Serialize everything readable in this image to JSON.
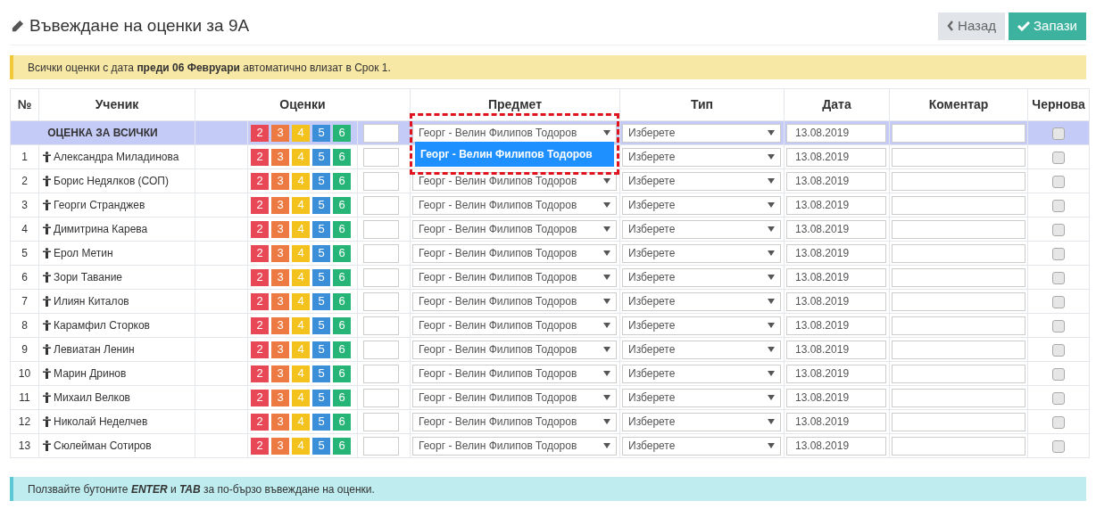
{
  "page_title": "Въвеждане на оценки за 9А",
  "buttons": [
    {
      "kind": "back",
      "label": "Назад"
    },
    {
      "kind": "save",
      "label": "Запази"
    }
  ],
  "notice": "Всички оценки с дата **преди 06 Февруари** автоматично влизат в Срок 1.",
  "table": {
    "columns": [
      "№",
      "Ученик",
      "Оценки",
      "Предмет",
      "Тип",
      "Дата",
      "Коментар",
      "Чернова"
    ],
    "all_row": {
      "label": "ОЦЕНКА ЗА ВСИЧКИ",
      "grades": [
        {
          "label": "2",
          "color": "#e84855"
        },
        {
          "label": "3",
          "color": "#ee7a43"
        },
        {
          "label": "4",
          "color": "#f4c21c"
        },
        {
          "label": "5",
          "color": "#3b8ed8"
        },
        {
          "label": "6",
          "color": "#27b477"
        }
      ],
      "subject": "Георг - Велин Филипов Тодоров",
      "subject_expanded": true,
      "subject_options": [
        {
          "label": "Георг - Велин Филипов Тодоров",
          "selected": true
        }
      ],
      "type": "Изберете",
      "date": "13.08.2019",
      "draft": false
    },
    "rows": [
      {
        "number": "1",
        "name": "Александра Миладинова",
        "grades": [
          "2",
          "3",
          "4",
          "5",
          "6"
        ],
        "type": "Изберете",
        "date": "13.08.2019",
        "draft": false
      },
      {
        "number": "2",
        "name": "Борис Недялков (СОП)",
        "grades": [
          "2",
          "3",
          "4",
          "5",
          "6"
        ],
        "subject": "Георг - Велин Филипов Тодоров",
        "type": "Изберете",
        "date": "13.08.2019",
        "draft": false
      },
      {
        "number": "3",
        "name": "Георги Странджев",
        "grades": [
          "2",
          "3",
          "4",
          "5",
          "6"
        ],
        "subject": "Георг - Велин Филипов Тодоров",
        "type": "Изберете",
        "date": "13.08.2019",
        "draft": false
      },
      {
        "number": "4",
        "name": "Димитрина Карева",
        "grades": [
          "2",
          "3",
          "4",
          "5",
          "6"
        ],
        "subject": "Георг - Велин Филипов Тодоров",
        "type": "Изберете",
        "date": "13.08.2019",
        "draft": false
      },
      {
        "number": "5",
        "name": "Ерол Метин",
        "grades": [
          "2",
          "3",
          "4",
          "5",
          "6"
        ],
        "subject": "Георг - Велин Филипов Тодоров",
        "type": "Изберете",
        "date": "13.08.2019",
        "draft": false
      },
      {
        "number": "6",
        "name": "Зори Тавание",
        "grades": [
          "2",
          "3",
          "4",
          "5",
          "6"
        ],
        "subject": "Георг - Велин Филипов Тодоров",
        "type": "Изберете",
        "date": "13.08.2019",
        "draft": false
      },
      {
        "number": "7",
        "name": "Илиян Киталов",
        "grades": [
          "2",
          "3",
          "4",
          "5",
          "6"
        ],
        "subject": "Георг - Велин Филипов Тодоров",
        "type": "Изберете",
        "date": "13.08.2019",
        "draft": false
      },
      {
        "number": "8",
        "name": "Карамфил Сторков",
        "grades": [
          "2",
          "3",
          "4",
          "5",
          "6"
        ],
        "subject": "Георг - Велин Филипов Тодоров",
        "type": "Изберете",
        "date": "13.08.2019",
        "draft": false
      },
      {
        "number": "9",
        "name": "Левиатан Ленин",
        "grades": [
          "2",
          "3",
          "4",
          "5",
          "6"
        ],
        "subject": "Георг - Велин Филипов Тодоров",
        "type": "Изберете",
        "date": "13.08.2019",
        "draft": false
      },
      {
        "number": "10",
        "name": "Марин Дринов",
        "grades": [
          "2",
          "3",
          "4",
          "5",
          "6"
        ],
        "subject": "Георг - Велин Филипов Тодоров",
        "type": "Изберете",
        "date": "13.08.2019",
        "draft": false
      },
      {
        "number": "11",
        "name": "Михаил Велков",
        "grades": [
          "2",
          "3",
          "4",
          "5",
          "6"
        ],
        "subject": "Георг - Велин Филипов Тодоров",
        "type": "Изберете",
        "date": "13.08.2019",
        "draft": false
      },
      {
        "number": "12",
        "name": "Николай Неделчев",
        "grades": [
          "2",
          "3",
          "4",
          "5",
          "6"
        ],
        "subject": "Георг - Велин Филипов Тодоров",
        "type": "Изберете",
        "date": "13.08.2019",
        "draft": false
      },
      {
        "number": "13",
        "name": "Сюлейман Сотиров",
        "grades": [
          "2",
          "3",
          "4",
          "5",
          "6"
        ],
        "subject": "Георг - Велин Филипов Тодоров",
        "type": "Изберете",
        "date": "13.08.2019",
        "draft": false
      }
    ]
  },
  "hint": "Ползвайте бутоните **ENTER** и **TAB** за по-бързо въвеждане на оценки."
}
